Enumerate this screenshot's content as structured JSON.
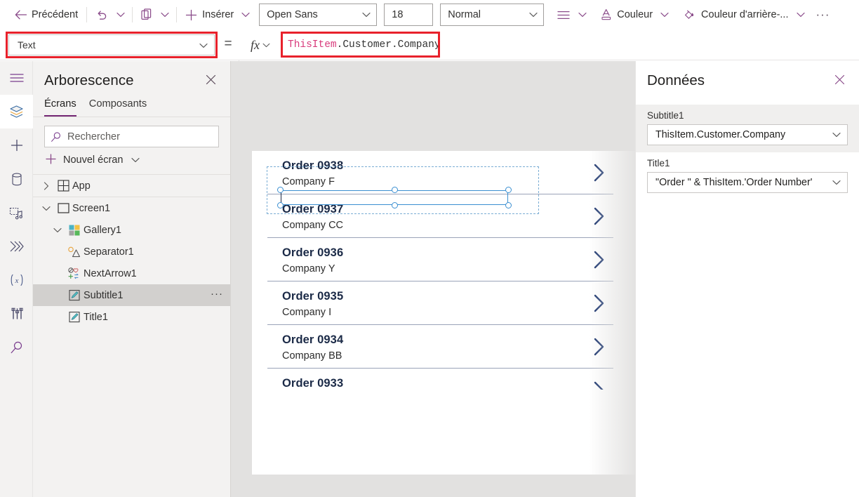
{
  "toolbar": {
    "back_label": "Précédent",
    "undo_icon": "undo-icon",
    "undo_caret_icon": "chevron-down-icon",
    "paste_icon": "clipboard-icon",
    "paste_caret_icon": "chevron-down-icon",
    "insert_label": "Insérer",
    "insert_icon": "plus-icon",
    "insert_caret_icon": "chevron-down-icon",
    "font_name": "Open Sans",
    "font_size": "18",
    "font_weight": "Normal",
    "align_icon": "align-lines-icon",
    "align_caret_icon": "chevron-down-icon",
    "color_label": "Couleur",
    "color_icon": "font-color-icon",
    "color_caret_icon": "chevron-down-icon",
    "fill_label": "Couleur d'arrière-...",
    "fill_icon": "fill-color-icon",
    "fill_caret_icon": "chevron-down-icon",
    "overflow_label": "···"
  },
  "formula_bar": {
    "property": "Text",
    "property_caret_icon": "chevron-down-icon",
    "equals": "=",
    "fx_label": "fx",
    "fx_caret_icon": "chevron-down-icon",
    "formula_token_1": "ThisItem",
    "formula_token_2": ".Customer.Company",
    "formula_full": "ThisItem.Customer.Company",
    "highlight_color": "#e8212b",
    "token_color": "#d83b7c"
  },
  "left_rail": {
    "items": [
      {
        "name": "hamburger-menu-icon",
        "selected": false
      },
      {
        "name": "layers-icon",
        "selected": true
      },
      {
        "name": "insert-plus-icon",
        "selected": false
      },
      {
        "name": "data-cylinder-icon",
        "selected": false
      },
      {
        "name": "media-icon",
        "selected": false
      },
      {
        "name": "power-automate-icon",
        "selected": false
      },
      {
        "name": "variables-icon",
        "selected": false
      },
      {
        "name": "tools-icon",
        "selected": false
      },
      {
        "name": "search-icon",
        "selected": false
      }
    ]
  },
  "tree_panel": {
    "title": "Arborescence",
    "close_icon": "close-icon",
    "tabs": [
      {
        "label": "Écrans",
        "selected": true
      },
      {
        "label": "Composants",
        "selected": false
      }
    ],
    "search_placeholder": "Rechercher",
    "search_value": "",
    "search_icon": "search-icon",
    "new_screen_label": "Nouvel écran",
    "new_screen_icon": "plus-icon",
    "new_screen_caret_icon": "chevron-down-icon",
    "nodes": [
      {
        "label": "App",
        "icon": "app-grid-icon",
        "expander": "chevron-right-icon",
        "indent": 0,
        "selected": false,
        "overflow": ""
      },
      {
        "label": "Screen1",
        "icon": "screen-rect-icon",
        "expander": "chevron-down-icon",
        "indent": 0,
        "selected": false,
        "overflow": ""
      },
      {
        "label": "Gallery1",
        "icon": "gallery-icon",
        "expander": "chevron-down-icon",
        "indent": 1,
        "selected": false,
        "overflow": ""
      },
      {
        "label": "Separator1",
        "icon": "shape-icon",
        "expander": "",
        "indent": 2,
        "selected": false,
        "overflow": ""
      },
      {
        "label": "NextArrow1",
        "icon": "icon-set-icon",
        "expander": "",
        "indent": 2,
        "selected": false,
        "overflow": ""
      },
      {
        "label": "Subtitle1",
        "icon": "label-pencil-icon",
        "expander": "",
        "indent": 2,
        "selected": true,
        "overflow": "···"
      },
      {
        "label": "Title1",
        "icon": "label-pencil-icon",
        "expander": "",
        "indent": 2,
        "selected": false,
        "overflow": ""
      }
    ]
  },
  "canvas": {
    "gallery_rows": [
      {
        "title": "Order 0938",
        "subtitle": "Company F",
        "chevron": "chevron-right-icon",
        "selected": true
      },
      {
        "title": "Order 0937",
        "subtitle": "Company CC",
        "chevron": "chevron-right-icon",
        "selected": false
      },
      {
        "title": "Order 0936",
        "subtitle": "Company Y",
        "chevron": "chevron-right-icon",
        "selected": false
      },
      {
        "title": "Order 0935",
        "subtitle": "Company I",
        "chevron": "chevron-right-icon",
        "selected": false
      },
      {
        "title": "Order 0934",
        "subtitle": "Company BB",
        "chevron": "chevron-right-icon",
        "selected": false
      },
      {
        "title": "Order 0933",
        "subtitle": "",
        "chevron": "chevron-right-icon",
        "selected": false
      }
    ],
    "selection_color": "#3a8fd1",
    "template_outline_color": "#7aadd4"
  },
  "data_panel": {
    "title": "Données",
    "close_icon": "close-icon",
    "fields": [
      {
        "label": "Subtitle1",
        "value": "ThisItem.Customer.Company",
        "caret_icon": "chevron-down-icon",
        "highlighted": true
      },
      {
        "label": "Title1",
        "value": "\"Order \" & ThisItem.'Order Number'",
        "caret_icon": "chevron-down-icon",
        "highlighted": false
      }
    ]
  }
}
